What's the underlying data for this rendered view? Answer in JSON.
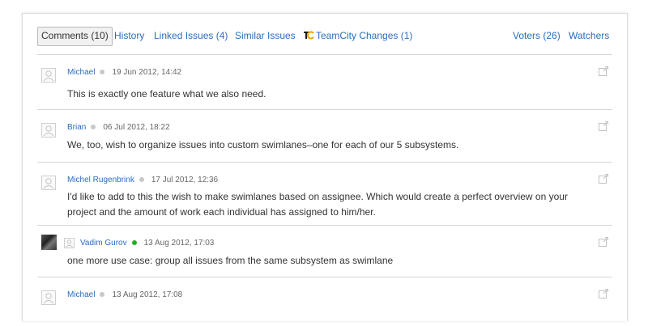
{
  "tabs": [
    {
      "label": "Comments (10)"
    },
    {
      "label": "History"
    },
    {
      "label": "Linked Issues (4)"
    },
    {
      "label": "Similar Issues"
    },
    {
      "label": "TeamCity Changes (1)"
    },
    {
      "label": "Voters (26)"
    },
    {
      "label": "Watchers"
    }
  ],
  "comments": [
    {
      "author": "Michael",
      "date": "19 Jun 2012, 14:42",
      "text": "This is exactly one feature what we also need."
    },
    {
      "author": "Brian",
      "date": "06 Jul 2012, 18:22",
      "text": "We, too, wish to organize issues into custom swimlanes–one for each of our 5 subsystems."
    },
    {
      "author": "Michel Rugenbrink",
      "date": "17 Jul 2012, 12:36",
      "text": "I'd like to add to this the wish to make swimlanes based on assignee. Which would create a perfect overview on your project and the amount of work each individual has assigned to him/her."
    },
    {
      "author": "Vadim Gurov",
      "date": "13 Aug 2012, 17:03",
      "text": "one more use case: group all issues from the same subsystem as swimlane"
    },
    {
      "author": "Michael",
      "date": "13 Aug 2012, 17:08",
      "text": ""
    }
  ],
  "colors": {
    "link": "#2a6dbf",
    "online": "#1db31d",
    "offline": "#c8c8c8"
  },
  "icons": {
    "avatar": "default-avatar-icon",
    "permalink": "external-link-icon",
    "teamcity": "teamcity-logo-icon"
  }
}
